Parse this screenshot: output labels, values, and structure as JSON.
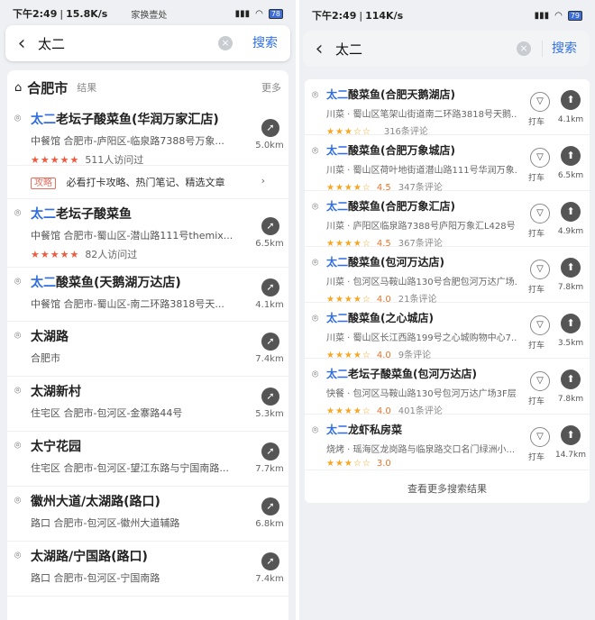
{
  "left": {
    "status": {
      "time": "下午2:49",
      "speed": "15.8K/s",
      "battery": "78",
      "overlay_text": "家换壹处"
    },
    "search": {
      "query": "太二",
      "button": "搜索"
    },
    "header": {
      "city": "合肥市",
      "results": "结果",
      "more": "更多"
    },
    "items": [
      {
        "hl": "太二",
        "rest": "老坛子酸菜鱼(华润万家汇店)",
        "sub": "中餐馆  合肥市-庐阳区-临泉路7388号万象...",
        "stars": "★★★★★",
        "visits": "511人访问过",
        "dist": "5.0km"
      },
      {
        "hl": "太二",
        "rest": "老坛子酸菜鱼",
        "sub": "中餐馆  合肥市-蜀山区-潜山路111号themix...",
        "stars": "★★★★★",
        "visits": "82人访问过",
        "dist": "6.5km"
      },
      {
        "hl": "太二",
        "rest": "酸菜鱼(天鹅湖万达店)",
        "sub": "中餐馆  合肥市-蜀山区-南二环路3818号天...",
        "stars": "",
        "visits": "",
        "dist": "4.1km"
      },
      {
        "hl": "",
        "rest": "太湖路",
        "sub": "合肥市",
        "stars": "",
        "visits": "",
        "dist": "7.4km"
      },
      {
        "hl": "",
        "rest": "太湖新村",
        "sub": "住宅区  合肥市-包河区-金寨路44号",
        "stars": "",
        "visits": "",
        "dist": "5.3km"
      },
      {
        "hl": "",
        "rest": "太宁花园",
        "sub": "住宅区  合肥市-包河区-望江东路与宁国南路...",
        "stars": "",
        "visits": "",
        "dist": "7.7km"
      },
      {
        "hl": "",
        "rest": "徽州大道/太湖路(路口)",
        "sub": "路口  合肥市-包河区-徽州大道辅路",
        "stars": "",
        "visits": "",
        "dist": "6.8km"
      },
      {
        "hl": "",
        "rest": "太湖路/宁国路(路口)",
        "sub": "路口  合肥市-包河区-宁国南路",
        "stars": "",
        "visits": "",
        "dist": "7.4km"
      }
    ],
    "guide": {
      "tag": "攻略",
      "text": "必看打卡攻略、热门笔记、精选文章",
      "arrow": "›"
    }
  },
  "right": {
    "status": {
      "time": "下午2:49",
      "speed": "114K/s",
      "battery": "79"
    },
    "search": {
      "query": "太二",
      "button": "搜索"
    },
    "taxi_label": "打车",
    "items": [
      {
        "hl": "太二",
        "rest": "酸菜鱼(合肥天鹅湖店)",
        "sub": "川菜 · 蜀山区笔架山街道南二环路3818号天鹅...",
        "stars": "★★★☆☆",
        "score": "",
        "reviews": "316条评论",
        "dist": "4.1km"
      },
      {
        "hl": "太二",
        "rest": "酸菜鱼(合肥万象城店)",
        "sub": "川菜 · 蜀山区荷叶地街道潜山路111号华润万象...",
        "stars": "★★★★☆",
        "score": "4.5",
        "reviews": "347条评论",
        "dist": "6.5km"
      },
      {
        "hl": "太二",
        "rest": "酸菜鱼(合肥万象汇店)",
        "sub": "川菜 · 庐阳区临泉路7388号庐阳万象汇L428号",
        "stars": "★★★★☆",
        "score": "4.5",
        "reviews": "367条评论",
        "dist": "4.9km"
      },
      {
        "hl": "太二",
        "rest": "酸菜鱼(包河万达店)",
        "sub": "川菜 · 包河区马鞍山路130号合肥包河万达广场...",
        "stars": "★★★★☆",
        "score": "4.0",
        "reviews": "21条评论",
        "dist": "7.8km"
      },
      {
        "hl": "太二",
        "rest": "酸菜鱼(之心城店)",
        "sub": "川菜 · 蜀山区长江西路199号之心城购物中心7...",
        "stars": "★★★★☆",
        "score": "4.0",
        "reviews": "9条评论",
        "dist": "3.5km"
      },
      {
        "hl": "太二",
        "rest": "老坛子酸菜鱼(包河万达店)",
        "sub": "快餐 · 包河区马鞍山路130号包河万达广场3F层...",
        "stars": "★★★★☆",
        "score": "4.0",
        "reviews": "401条评论",
        "dist": "7.8km"
      },
      {
        "hl": "太二",
        "rest": "龙虾私房菜",
        "sub": "烧烤 · 瑶海区龙岗路与临泉路交口名门绿洲小...",
        "stars": "★★★☆☆",
        "score": "3.0",
        "reviews": "",
        "dist": "14.7km"
      }
    ],
    "see_more": "查看更多搜索结果"
  }
}
